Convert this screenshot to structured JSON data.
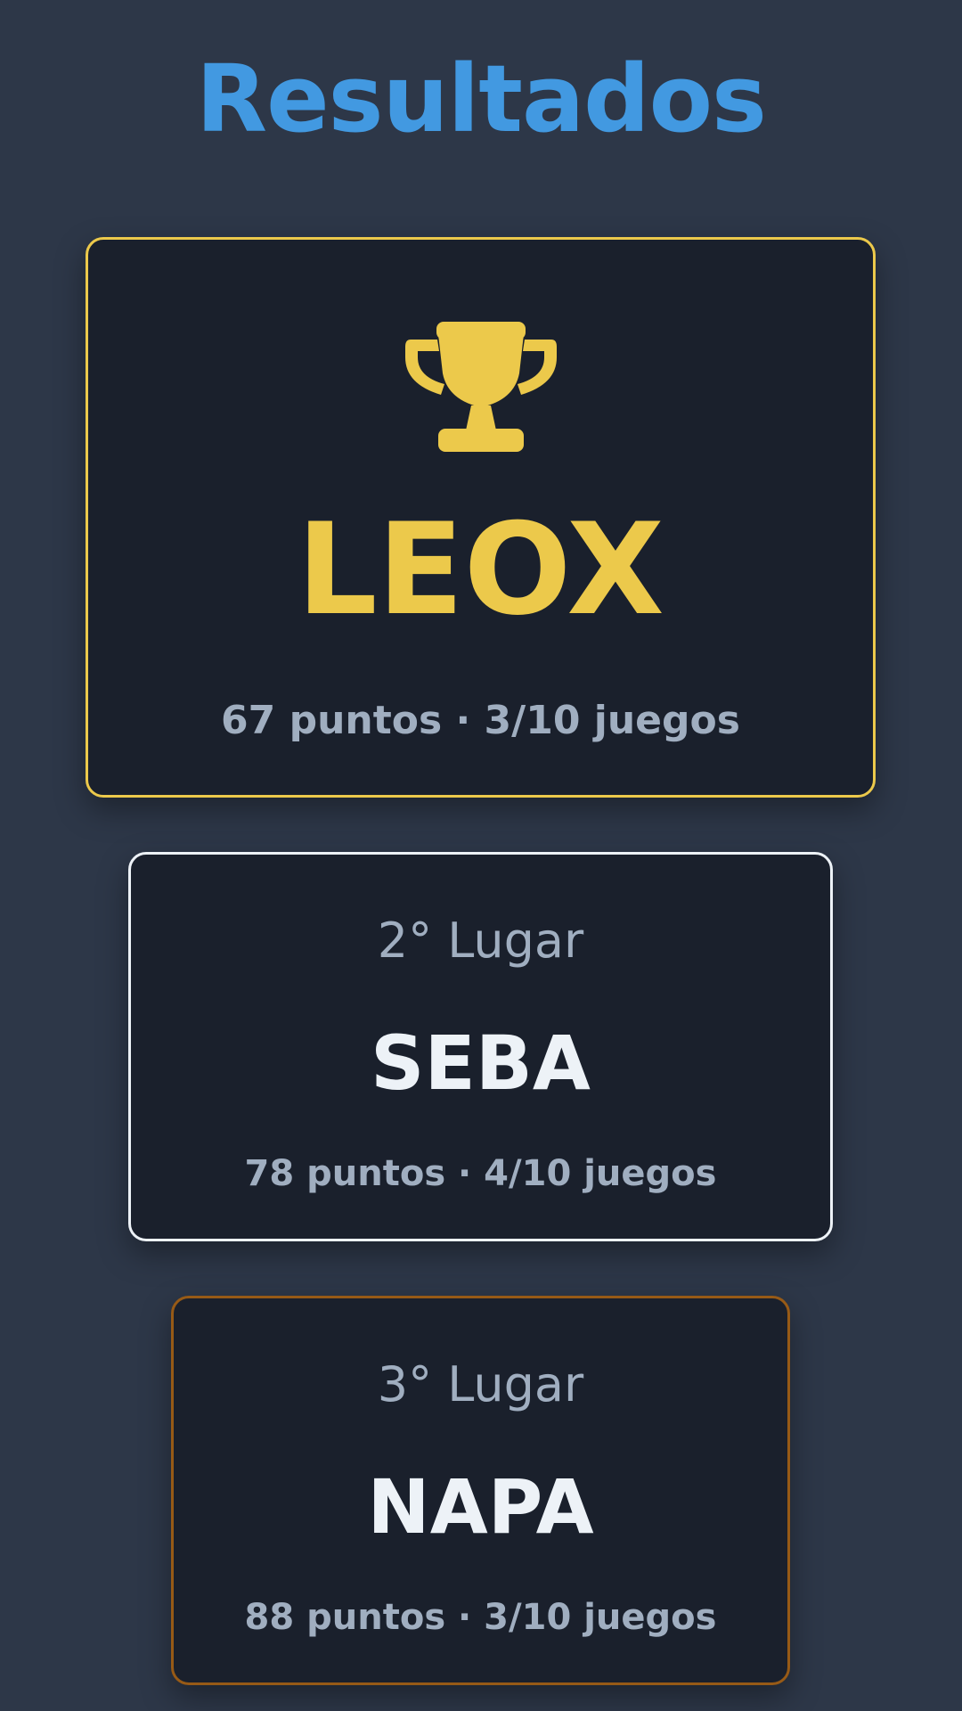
{
  "header": {
    "title": "Resultados"
  },
  "results": {
    "first": {
      "icon": "trophy-icon",
      "name": "LEOX",
      "stats": "67 puntos · 3/10 juegos",
      "accent": "#ecc94b"
    },
    "second": {
      "place": "2° Lugar",
      "name": "SEBA",
      "stats": "78 puntos · 4/10 juegos",
      "accent": "#edf2f7"
    },
    "third": {
      "place": "3° Lugar",
      "name": "NAPA",
      "stats": "88 puntos · 3/10 juegos",
      "accent": "#975a16"
    }
  },
  "colors": {
    "background": "#2d3748",
    "card": "#1a202c",
    "title": "#4299e1",
    "muted": "#a0aec0"
  }
}
